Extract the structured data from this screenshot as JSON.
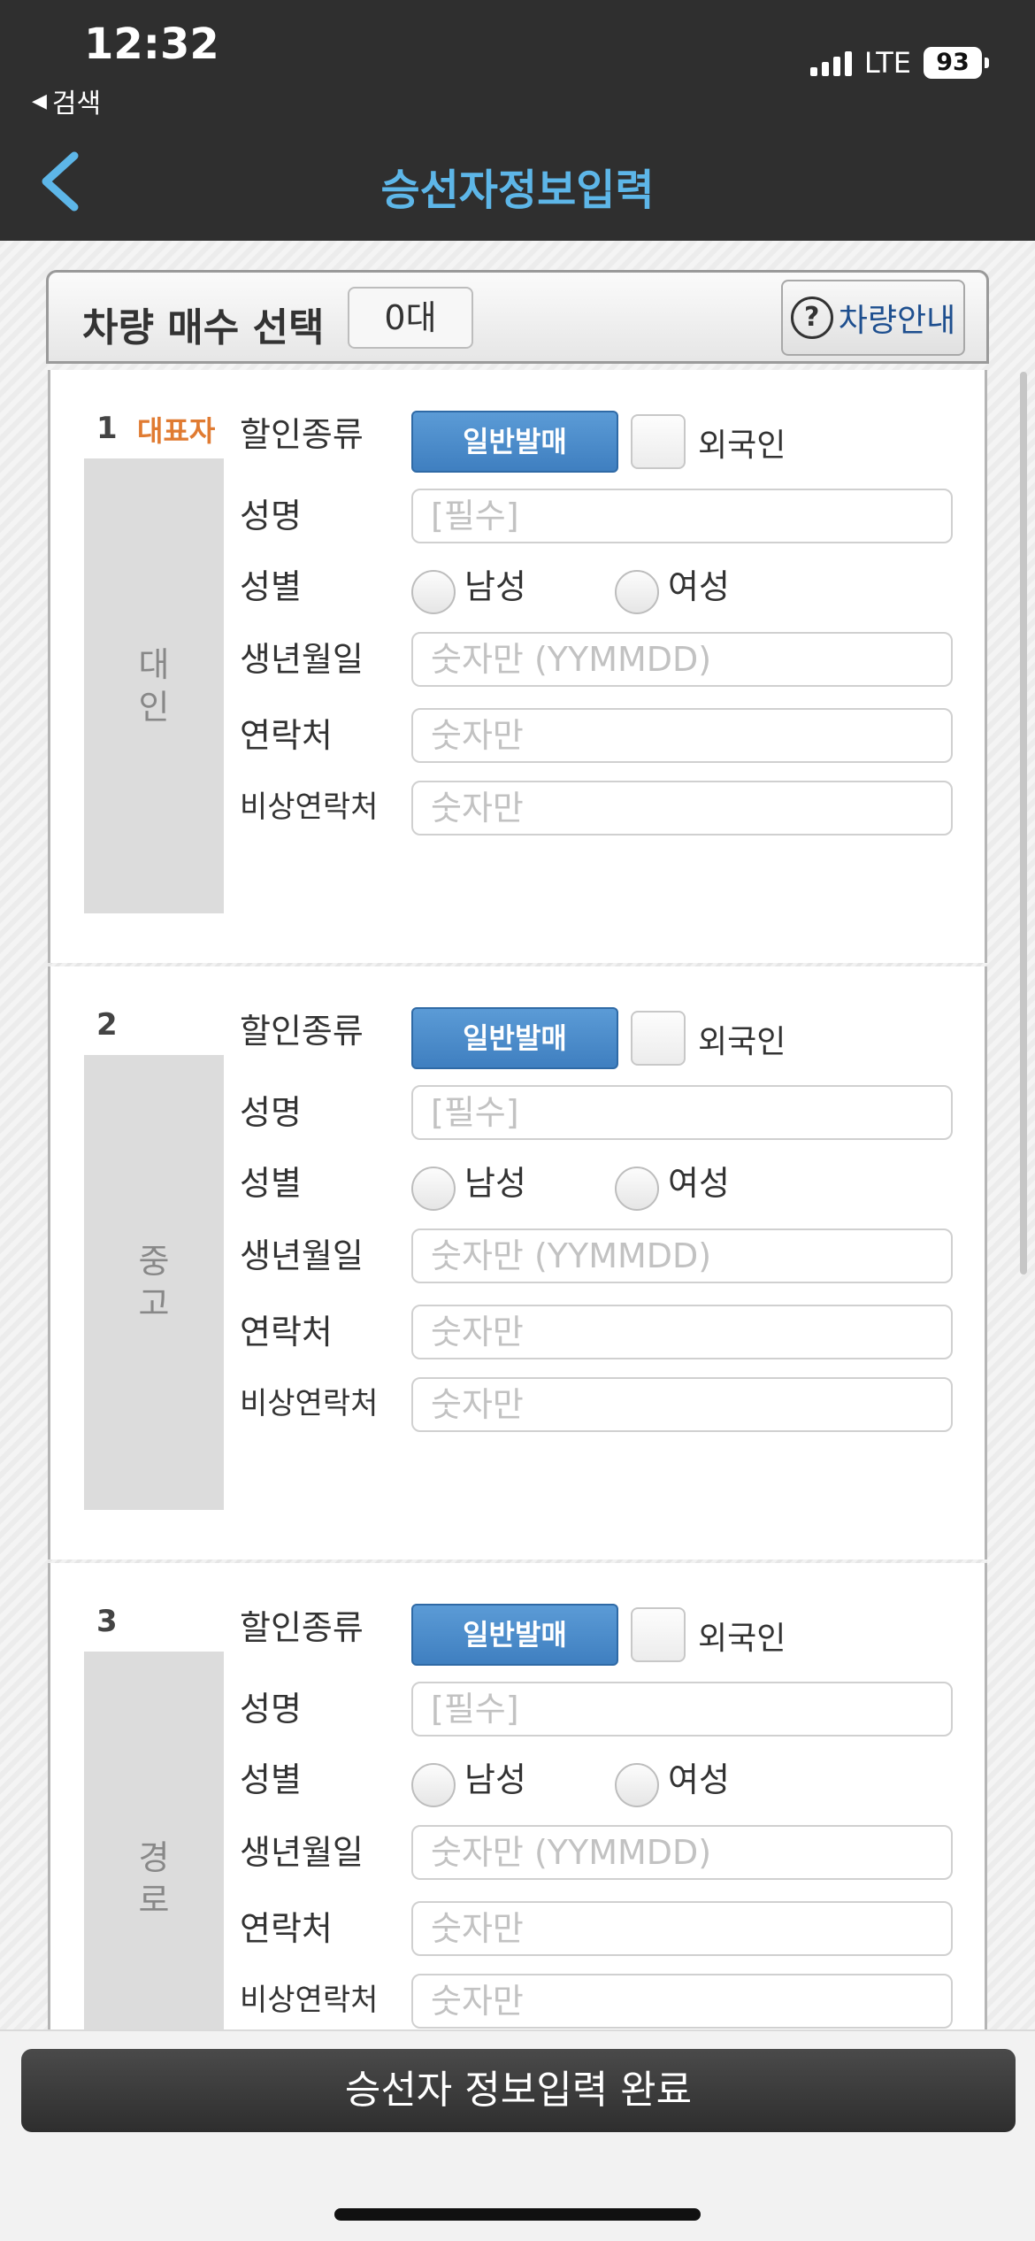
{
  "status_bar": {
    "time": "12:32",
    "back_label": "검색",
    "network": "LTE",
    "battery": "93"
  },
  "header": {
    "title": "승선자정보입력"
  },
  "vehicle": {
    "label": "차량 매수 선택",
    "count": "0대",
    "guide_label": "차량안내",
    "guide_icon": "?"
  },
  "form_labels": {
    "discount_type": "할인종류",
    "name": "성명",
    "gender": "성별",
    "birth": "생년월일",
    "contact": "연락처",
    "emergency": "비상연락처",
    "male": "남성",
    "female": "여성",
    "foreigner": "외국인",
    "discount_value": "일반발매",
    "name_placeholder": "[필수]",
    "birth_placeholder": "숫자만 (YYMMDD)",
    "digits_placeholder": "숫자만"
  },
  "passengers": [
    {
      "number": "1",
      "badge": "대표자",
      "type": "대인"
    },
    {
      "number": "2",
      "badge": "",
      "type": "중고"
    },
    {
      "number": "3",
      "badge": "",
      "type": "경로"
    }
  ],
  "footer": {
    "submit_label": "승선자 정보입력 완료"
  }
}
